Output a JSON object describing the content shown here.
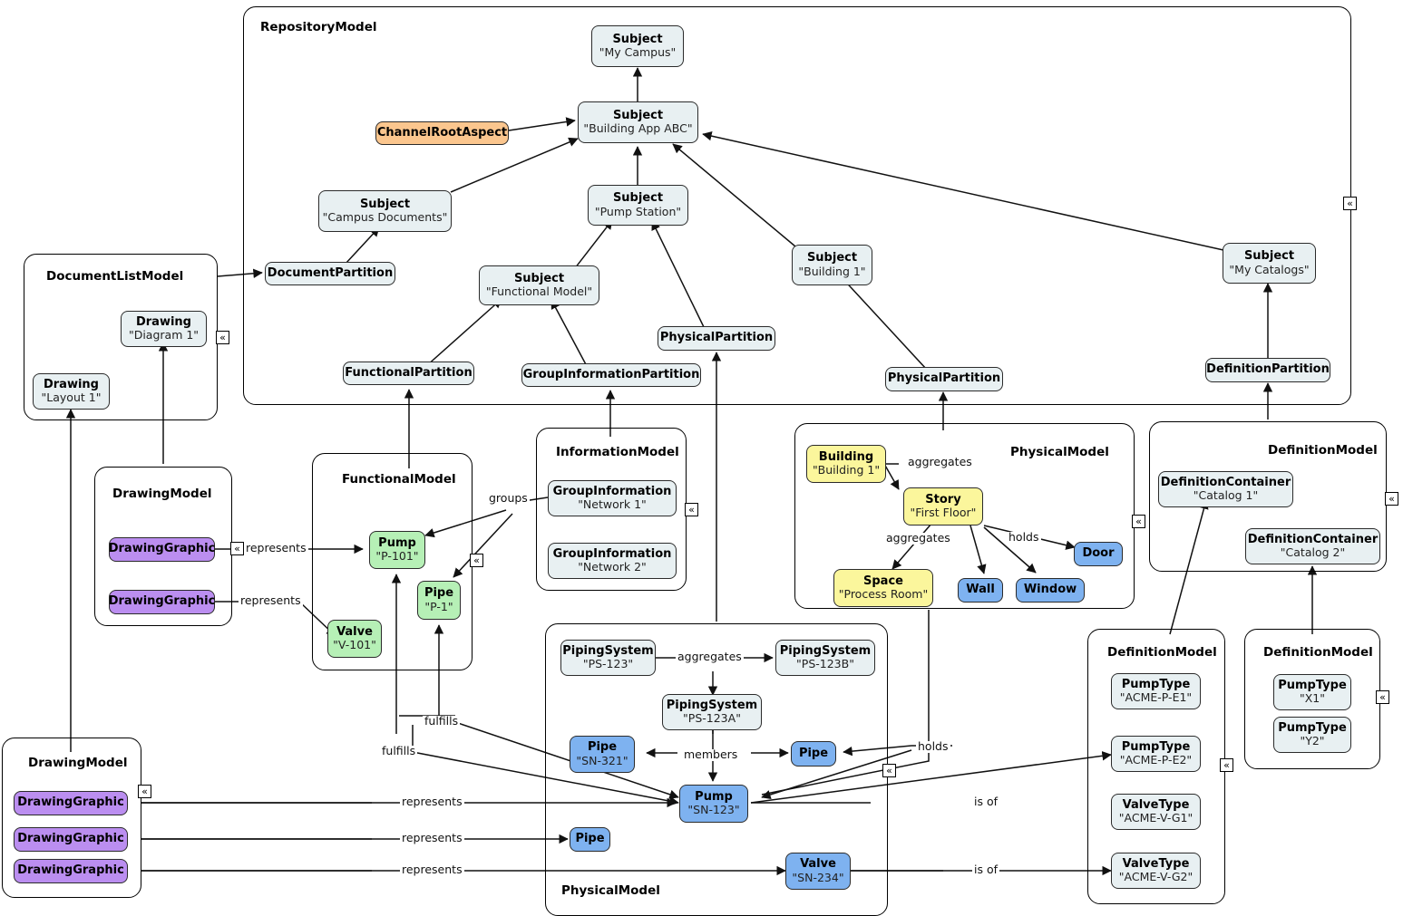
{
  "diagram": {
    "title": "RepositoryModel",
    "colors": {
      "node_default": "#e8f0f2",
      "aspect": "#fbc68e",
      "functional": "#b6f0b6",
      "drawing_graphic": "#bb8ef0",
      "spatial": "#fbf69c",
      "physical": "#7eb2f0",
      "stroke": "#2b2b2b"
    }
  },
  "containers": [
    {
      "id": "repositoryModel",
      "label": "RepositoryModel"
    },
    {
      "id": "documentListModel",
      "label": "DocumentListModel"
    },
    {
      "id": "drawingModelTop",
      "label": "DrawingModel"
    },
    {
      "id": "functionalModel",
      "label": "FunctionalModel"
    },
    {
      "id": "informationModel",
      "label": "InformationModel"
    },
    {
      "id": "physicalModelTop",
      "label": "PhysicalModel"
    },
    {
      "id": "definitionModelTop",
      "label": "DefinitionModel"
    },
    {
      "id": "physicalModelBot",
      "label": "PhysicalModel"
    },
    {
      "id": "definitionModelMid",
      "label": "DefinitionModel"
    },
    {
      "id": "definitionModelRight",
      "label": "DefinitionModel"
    },
    {
      "id": "drawingModelBot",
      "label": "DrawingModel"
    }
  ],
  "nodes": [
    {
      "id": "subj_my_campus",
      "type": "Subject",
      "name": "\"My Campus\""
    },
    {
      "id": "subj_building_app",
      "type": "Subject",
      "name": "\"Building App ABC\""
    },
    {
      "id": "channel_root_aspect",
      "type": "ChannelRootAspect",
      "name": ""
    },
    {
      "id": "subj_campus_docs",
      "type": "Subject",
      "name": "\"Campus Documents\""
    },
    {
      "id": "subj_pump_station",
      "type": "Subject",
      "name": "\"Pump Station\""
    },
    {
      "id": "subj_building_1",
      "type": "Subject",
      "name": "\"Building 1\""
    },
    {
      "id": "subj_my_catalogs",
      "type": "Subject",
      "name": "\"My Catalogs\""
    },
    {
      "id": "document_partition",
      "type": "DocumentPartition",
      "name": ""
    },
    {
      "id": "subj_functional_model",
      "type": "Subject",
      "name": "\"Functional Model\""
    },
    {
      "id": "functional_partition",
      "type": "FunctionalPartition",
      "name": ""
    },
    {
      "id": "groupinfo_partition",
      "type": "GroupInformationPartition",
      "name": ""
    },
    {
      "id": "physical_partition_1",
      "type": "PhysicalPartition",
      "name": ""
    },
    {
      "id": "physical_partition_2",
      "type": "PhysicalPartition",
      "name": ""
    },
    {
      "id": "definition_partition",
      "type": "DefinitionPartition",
      "name": ""
    },
    {
      "id": "drawing_diagram1",
      "type": "Drawing",
      "name": "\"Diagram 1\""
    },
    {
      "id": "drawing_layout1",
      "type": "Drawing",
      "name": "\"Layout 1\""
    },
    {
      "id": "dg_top_1",
      "type": "DrawingGraphic",
      "name": ""
    },
    {
      "id": "dg_top_2",
      "type": "DrawingGraphic",
      "name": ""
    },
    {
      "id": "pump_p101",
      "type": "Pump",
      "name": "\"P-101\""
    },
    {
      "id": "pipe_p1",
      "type": "Pipe",
      "name": "\"P-1\""
    },
    {
      "id": "valve_v101",
      "type": "Valve",
      "name": "\"V-101\""
    },
    {
      "id": "groupinfo_net1",
      "type": "GroupInformation",
      "name": "\"Network 1\""
    },
    {
      "id": "groupinfo_net2",
      "type": "GroupInformation",
      "name": "\"Network 2\""
    },
    {
      "id": "building_1",
      "type": "Building",
      "name": "\"Building 1\""
    },
    {
      "id": "story_first_floor",
      "type": "Story",
      "name": "\"First Floor\""
    },
    {
      "id": "space_process_room",
      "type": "Space",
      "name": "\"Process Room\""
    },
    {
      "id": "wall",
      "type": "Wall",
      "name": ""
    },
    {
      "id": "window",
      "type": "Window",
      "name": ""
    },
    {
      "id": "door",
      "type": "Door",
      "name": ""
    },
    {
      "id": "defcontainer_cat1",
      "type": "DefinitionContainer",
      "name": "\"Catalog 1\""
    },
    {
      "id": "defcontainer_cat2",
      "type": "DefinitionContainer",
      "name": "\"Catalog 2\""
    },
    {
      "id": "ps_123",
      "type": "PipingSystem",
      "name": "\"PS-123\""
    },
    {
      "id": "ps_123b",
      "type": "PipingSystem",
      "name": "\"PS-123B\""
    },
    {
      "id": "ps_123a",
      "type": "PipingSystem",
      "name": "\"PS-123A\""
    },
    {
      "id": "pipe_sn321",
      "type": "Pipe",
      "name": "\"SN-321\""
    },
    {
      "id": "pipe_plain_1",
      "type": "Pipe",
      "name": ""
    },
    {
      "id": "pump_sn123",
      "type": "Pump",
      "name": "\"SN-123\""
    },
    {
      "id": "pipe_plain_2",
      "type": "Pipe",
      "name": ""
    },
    {
      "id": "valve_sn234",
      "type": "Valve",
      "name": "\"SN-234\""
    },
    {
      "id": "pumptype_e1",
      "type": "PumpType",
      "name": "\"ACME-P-E1\""
    },
    {
      "id": "pumptype_e2",
      "type": "PumpType",
      "name": "\"ACME-P-E2\""
    },
    {
      "id": "valvetype_g1",
      "type": "ValveType",
      "name": "\"ACME-V-G1\""
    },
    {
      "id": "valvetype_g2",
      "type": "ValveType",
      "name": "\"ACME-V-G2\""
    },
    {
      "id": "pumptype_x1",
      "type": "PumpType",
      "name": "\"X1\""
    },
    {
      "id": "pumptype_y2",
      "type": "PumpType",
      "name": "\"Y2\""
    },
    {
      "id": "dg_bot_1",
      "type": "DrawingGraphic",
      "name": ""
    },
    {
      "id": "dg_bot_2",
      "type": "DrawingGraphic",
      "name": ""
    },
    {
      "id": "dg_bot_3",
      "type": "DrawingGraphic",
      "name": ""
    }
  ],
  "edge_labels": [
    {
      "id": "lbl_groups",
      "text": "groups"
    },
    {
      "id": "lbl_represents_1",
      "text": "represents"
    },
    {
      "id": "lbl_represents_2",
      "text": "represents"
    },
    {
      "id": "lbl_represents_3",
      "text": "represents"
    },
    {
      "id": "lbl_represents_4",
      "text": "represents"
    },
    {
      "id": "lbl_represents_5",
      "text": "represents"
    },
    {
      "id": "lbl_aggregates_1",
      "text": "aggregates"
    },
    {
      "id": "lbl_aggregates_2",
      "text": "aggregates"
    },
    {
      "id": "lbl_aggregates_3",
      "text": "aggregates"
    },
    {
      "id": "lbl_holds_1",
      "text": "holds"
    },
    {
      "id": "lbl_holds_2",
      "text": "holds"
    },
    {
      "id": "lbl_members",
      "text": "members"
    },
    {
      "id": "lbl_fulfills_1",
      "text": "fulfills"
    },
    {
      "id": "lbl_fulfills_2",
      "text": "fulfills"
    },
    {
      "id": "lbl_isof_1",
      "text": "is of"
    },
    {
      "id": "lbl_isof_2",
      "text": "is of"
    }
  ],
  "handles": {
    "glyph": "«",
    "count": 9
  }
}
